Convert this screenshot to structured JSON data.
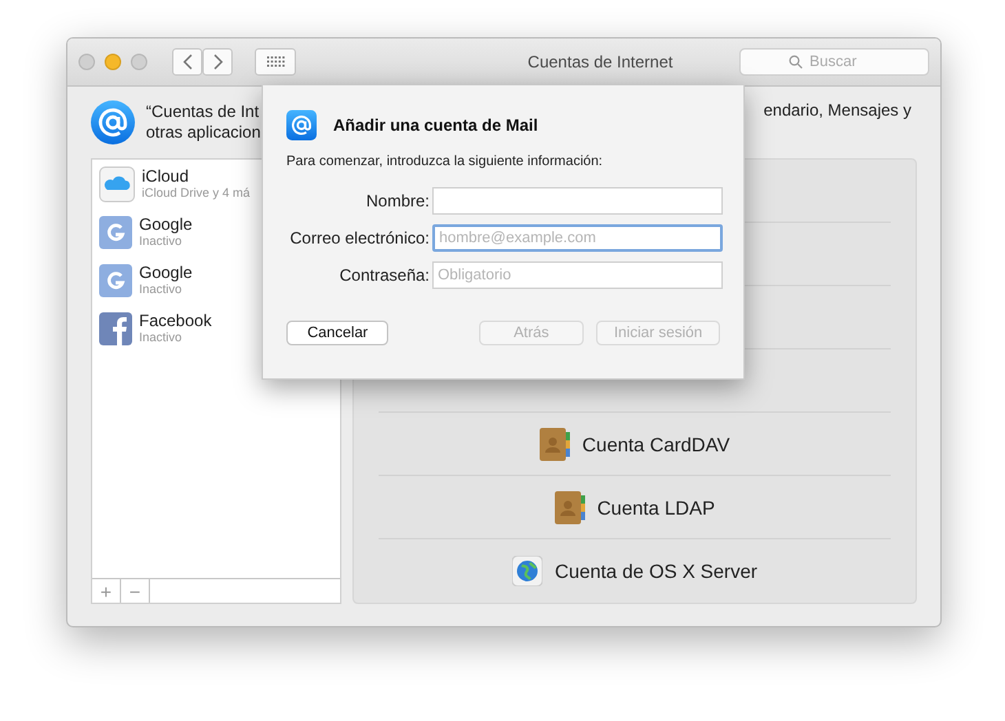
{
  "window": {
    "title": "Cuentas de Internet",
    "search": {
      "placeholder": "Buscar"
    }
  },
  "header": {
    "text_left": [
      "“Cuentas de Int",
      "otras aplicacion"
    ],
    "text_right": "endario, Mensajes y"
  },
  "accounts": [
    {
      "name": "iCloud",
      "status": "iCloud Drive y 4 má",
      "kind": "icloud"
    },
    {
      "name": "Google",
      "status": "Inactivo",
      "kind": "google"
    },
    {
      "name": "Google",
      "status": "Inactivo",
      "kind": "google"
    },
    {
      "name": "Facebook",
      "status": "Inactivo",
      "kind": "facebook"
    }
  ],
  "list_buttons": [
    "+",
    "−"
  ],
  "providers": [
    {
      "label": "Cuenta CardDAV",
      "kind": "contacts"
    },
    {
      "label": "Cuenta LDAP",
      "kind": "contacts"
    },
    {
      "label": "Cuenta de OS X Server",
      "kind": "globe"
    }
  ],
  "dialog": {
    "title": "Añadir una cuenta de Mail",
    "intro": "Para comenzar, introduzca la siguiente información:",
    "fields": [
      {
        "label": "Nombre:",
        "focused": false
      },
      {
        "label": "Correo electrónico:",
        "placeholder": "hombre@example.com",
        "focused": true
      },
      {
        "label": "Contraseña:",
        "placeholder": "Obligatorio",
        "focused": false
      }
    ],
    "buttons": [
      {
        "label": "Cancelar",
        "disabled": false
      },
      {
        "label": "Atrás",
        "disabled": true
      },
      {
        "label": "Iniciar sesión",
        "disabled": true
      }
    ]
  }
}
